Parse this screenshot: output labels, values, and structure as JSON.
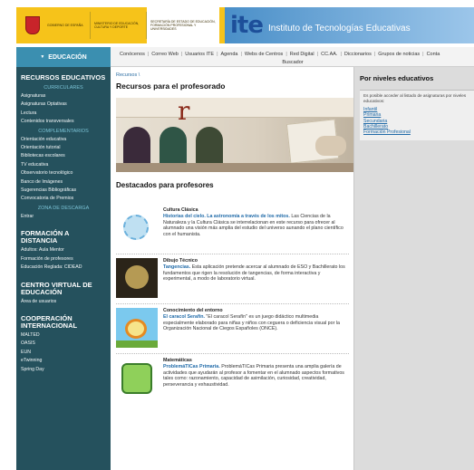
{
  "header": {
    "gov": {
      "line1": "GOBIERNO DE ESPAÑA",
      "line2": "MINISTERIO DE EDUCACIÓN, CULTURA Y DEPORTE",
      "line3": "SECRETARÍA DE ESTADO DE EDUCACIÓN, FORMACIÓN PROFESIONAL Y UNIVERSIDADES"
    },
    "logo": "ite",
    "site_name": "Instituto de Tecnologías Educativas"
  },
  "nav": {
    "section_button": "EDUCACIÓN",
    "links": [
      "Conócenos",
      "Correo Web",
      "Usuarios ITE",
      "Agenda",
      "Webs de Centros",
      "Red Digital",
      "CC.AA.",
      "Diccionarios",
      "Grupos de noticias",
      "Conta",
      "Buscador"
    ]
  },
  "sidebar": {
    "groups": [
      {
        "heading": "RECURSOS EDUCATIVOS",
        "subsections": [
          {
            "title": "CURRICULARES",
            "items": [
              "Asignaturas",
              "Asignaturas Optativas",
              "Lectura",
              "Contenidos transversales"
            ]
          },
          {
            "title": "COMPLEMENTARIOS",
            "items": [
              "Orientación educativa",
              "Orientación tutorial",
              "Bibliotecas escolares",
              "TV educativa",
              "Observatorio tecnológico",
              "Banco de Imágenes",
              "Sugerencias Bibliográficas",
              "Convocatoria de Premios"
            ]
          },
          {
            "title": "ZONA DE DESCARGA",
            "items": [
              "Entrar"
            ]
          }
        ]
      },
      {
        "heading": "FORMACIÓN A DISTANCIA",
        "subsections": [
          {
            "title": "",
            "items": [
              "Adultos: Aula Mentor",
              "Formación de profesores",
              "Educación Reglada: CIDEAD"
            ]
          }
        ]
      },
      {
        "heading": "CENTRO VIRTUAL DE EDUCACIÓN",
        "subsections": [
          {
            "title": "",
            "items": [
              "Área de usuarios"
            ]
          }
        ]
      },
      {
        "heading": "COOPERACIÓN INTERNACIONAL",
        "subsections": [
          {
            "title": "",
            "items": [
              "MALTED",
              "OASIS",
              "EUN",
              "eTwinning",
              "Spring Day"
            ]
          }
        ]
      }
    ]
  },
  "main": {
    "breadcrumb": "Recursos \\",
    "title": "Recursos para el profesorado",
    "featured_title": "Destacados para profesores",
    "featured": [
      {
        "category": "Cultura Clásica",
        "link": "Historias del cielo. La astronomía a través de los mitos.",
        "desc": "Las Ciencias de la Naturaleza y la Cultura Clásica se interrelacionan en este recurso para ofrecer al alumnado una visión más amplia del estudio del universo aunando el plano científico con el humanista.",
        "icon": "sun-icon"
      },
      {
        "category": "Dibujo Técnico",
        "link": "Tangencias.",
        "desc": "Esta aplicación pretende acercar al alumnado de ESO y Bachillerato los fundamentos que rigen la resolución de tangencias, de forma interactiva y experimental, a modo de laboratorio virtual.",
        "icon": "drawing-icon"
      },
      {
        "category": "Conocimiento del entorno",
        "link": "El caracol Serafín.",
        "desc": "\"El caracol Serafín\" es un juego didáctico multimedia especialmente elaborado para niñas y niños con ceguera o deficiencia visual por la Organización Nacional de Ciegos Españoles (ONCE).",
        "icon": "snail-icon"
      },
      {
        "category": "Matemáticas",
        "link": "ProblemáTICas Primaria.",
        "desc": "ProblemáTICas Primaria presenta una amplia galería de actividades que ayudarán al profesor a fomentar en el alumnado aspectos formativos tales como: razonamiento, capacidad de asimilación, curiosidad, creatividad, perseverancia y exhaustividad.",
        "icon": "puzzle-icon"
      }
    ]
  },
  "right": {
    "heading": "Por niveles educativos",
    "note": "Es posible acceder al listado de asignaturas por niveles educativos:",
    "levels": [
      "Infantil",
      "Primaria",
      "Secundaria",
      "Bachillerato",
      "Formación Profesional"
    ]
  }
}
